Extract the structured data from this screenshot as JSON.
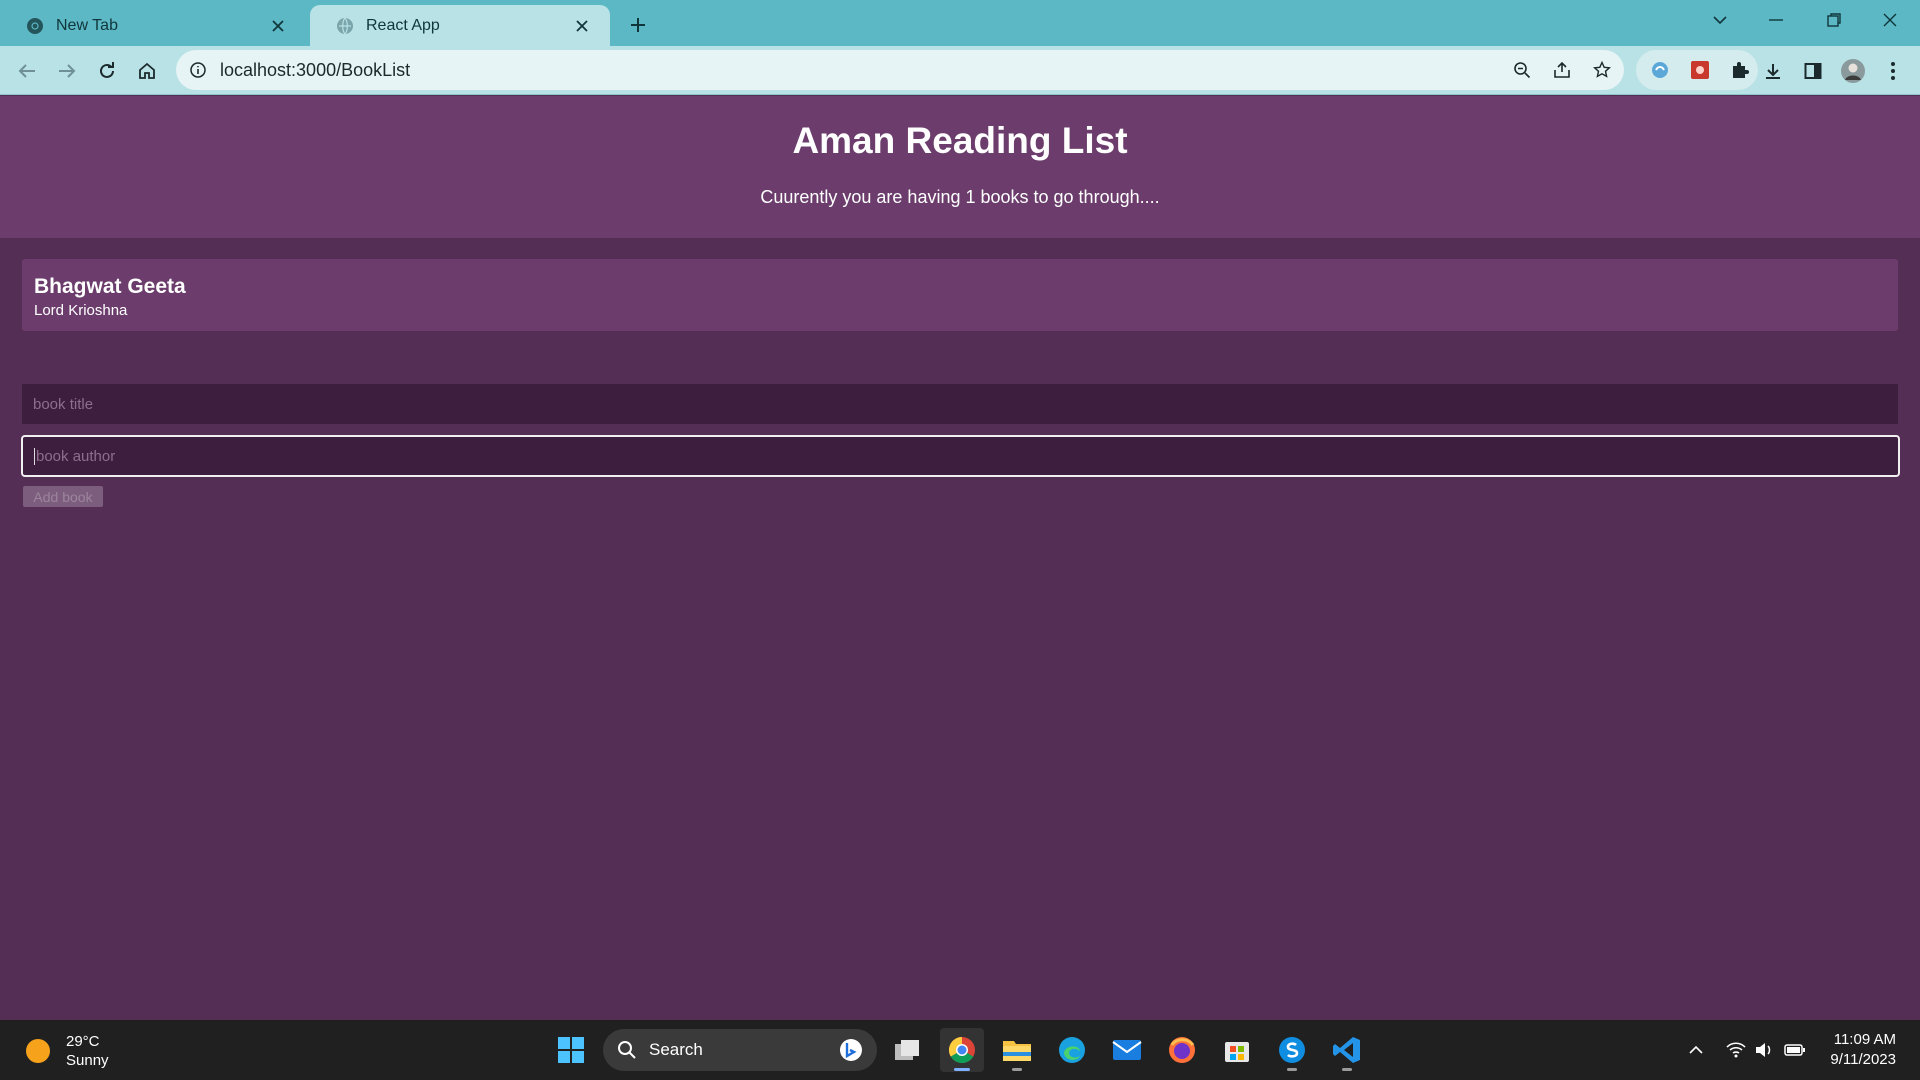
{
  "browser": {
    "tabs": [
      {
        "label": "New Tab",
        "icon": "chrome-icon"
      },
      {
        "label": "React App",
        "icon": "globe-icon",
        "active": true
      }
    ],
    "url_host": "localhost",
    "url_path": ":3000/BookList"
  },
  "app": {
    "title": "Aman Reading List",
    "subtitle": "Cuurently you are having 1 books to go through....",
    "books": [
      {
        "title": "Bhagwat Geeta",
        "author": "Lord Krioshna"
      }
    ],
    "form": {
      "title_placeholder": "book title",
      "author_placeholder": "book author",
      "submit_label": "Add book"
    },
    "colors": {
      "header_bg": "#6c3d6c",
      "page_bg": "#542e54",
      "input_bg": "#3d1e3e"
    }
  },
  "taskbar": {
    "weather_temp": "29°C",
    "weather_desc": "Sunny",
    "search_label": "Search",
    "time": "11:09 AM",
    "date": "9/11/2023"
  }
}
